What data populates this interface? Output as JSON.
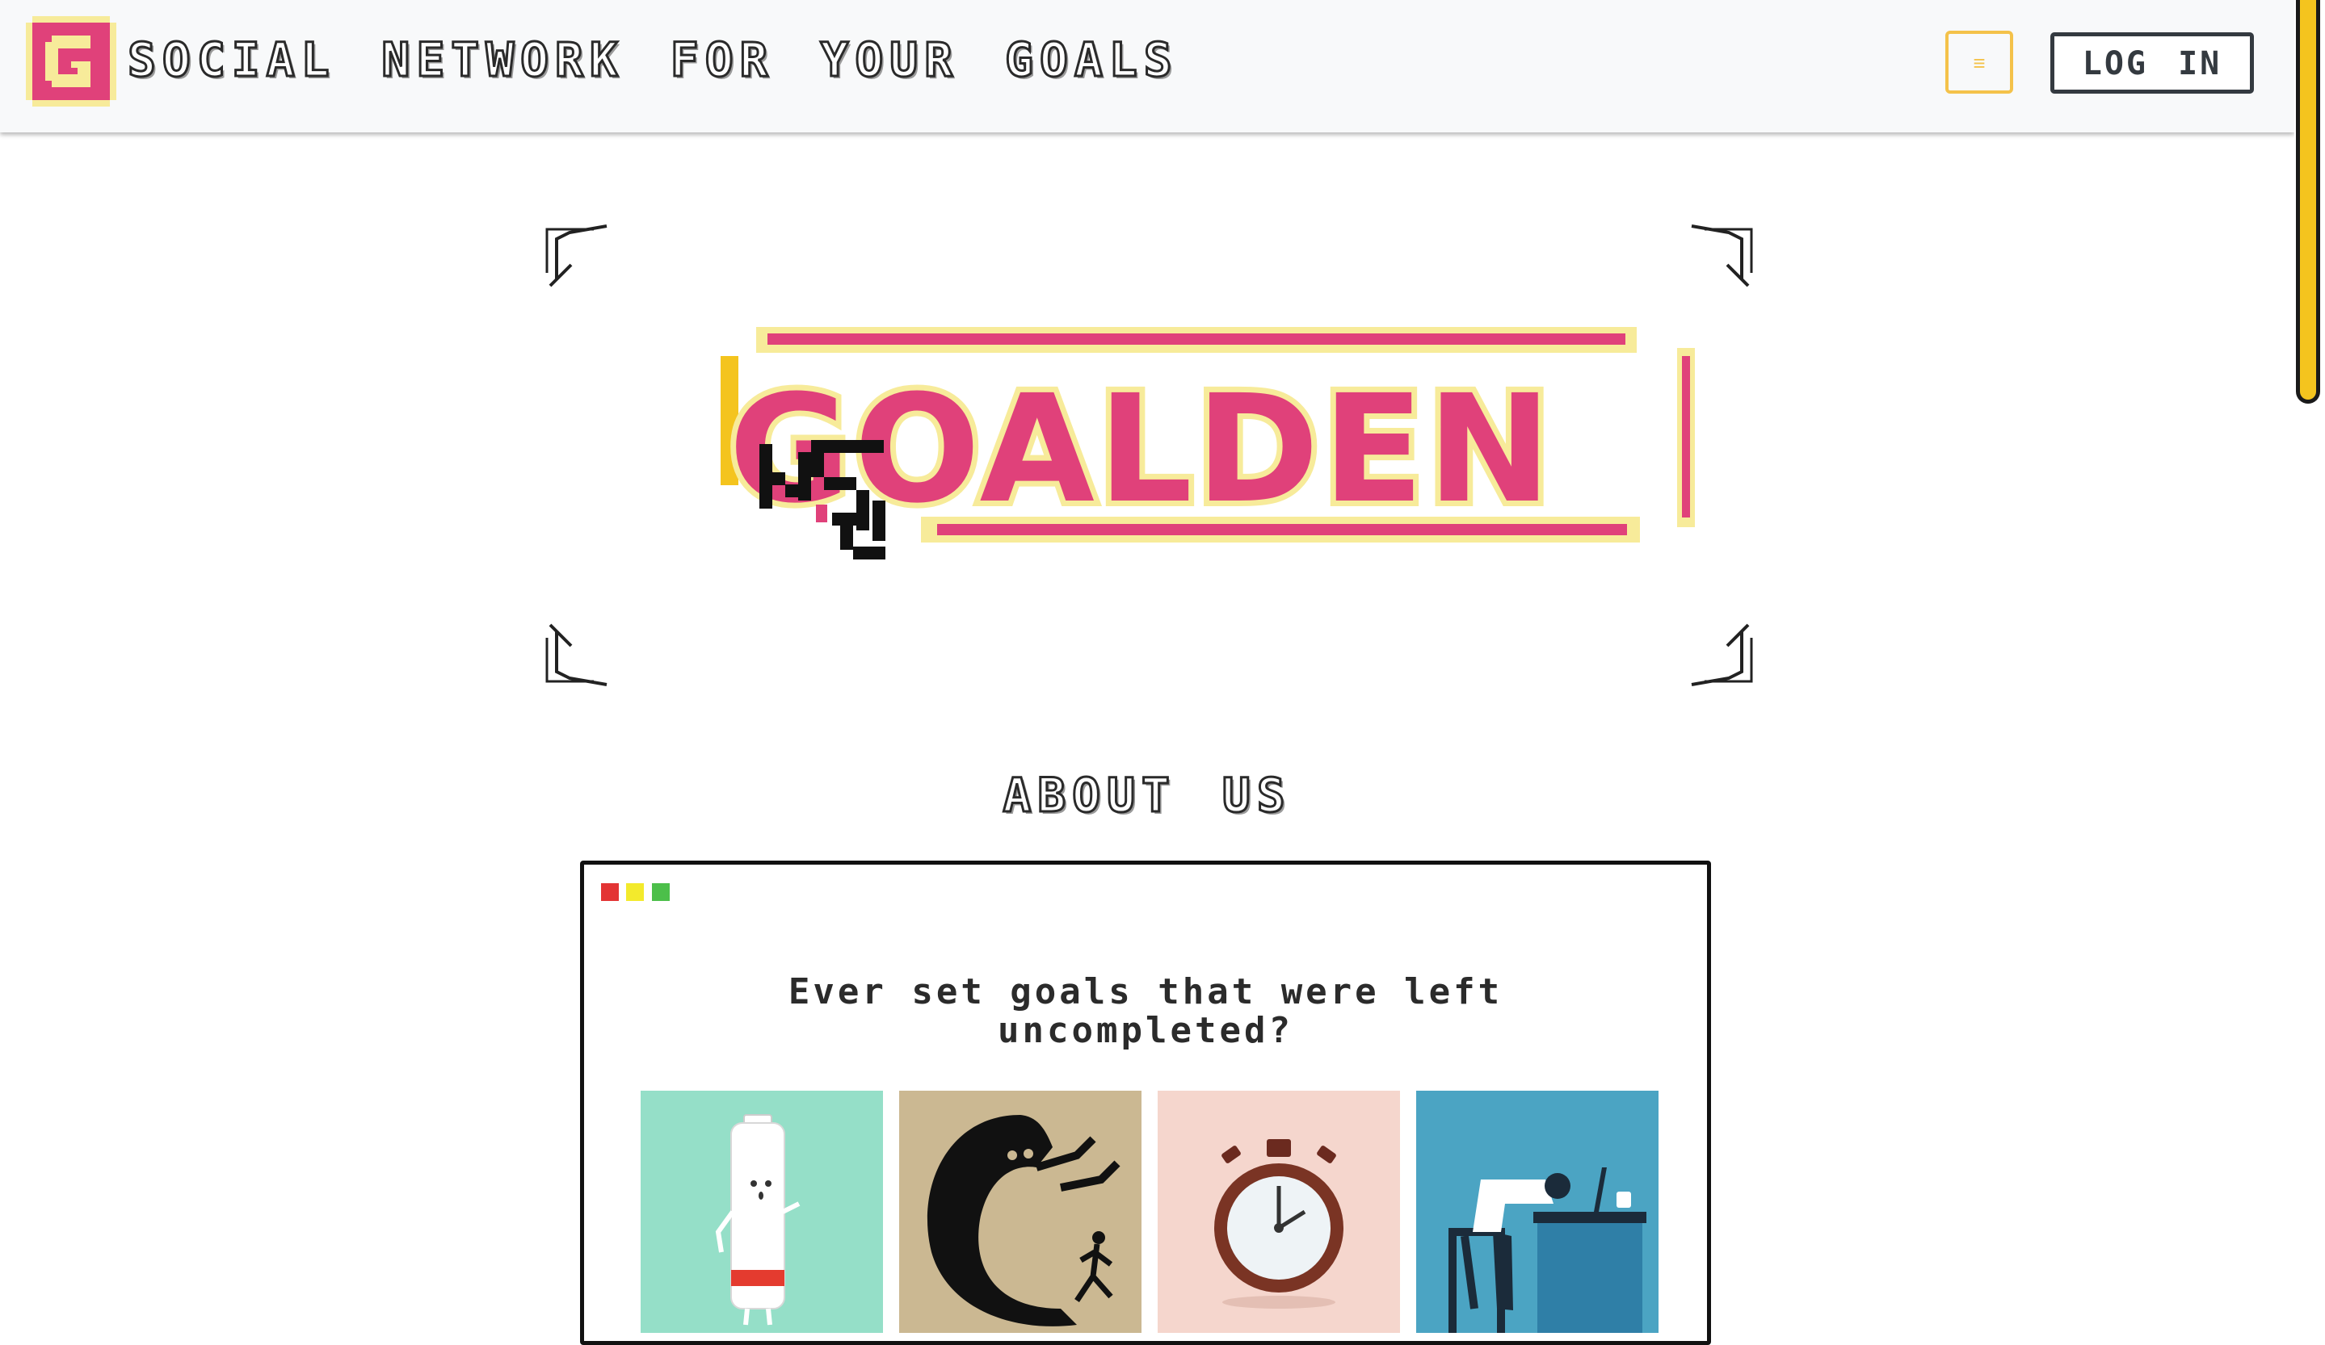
{
  "header": {
    "site_title": "Social network for your goals",
    "menu_icon": "hamburger-icon",
    "menu_glyph": "≡",
    "login_label": "LOG IN"
  },
  "hero": {
    "logo_text": "GOALDEN"
  },
  "about": {
    "title": "About us",
    "question": "Ever set goals that were left uncompleted?",
    "window_dots": [
      "red",
      "yellow",
      "green"
    ],
    "images": [
      {
        "name": "low-battery-character-image"
      },
      {
        "name": "shadow-monster-chasing-man-image"
      },
      {
        "name": "stopwatch-image"
      },
      {
        "name": "tired-office-worker-image"
      }
    ]
  },
  "colors": {
    "accent_yellow": "#f4c24a",
    "brand_pink": "#e0417a",
    "brand_cream": "#f7eb9a",
    "dark": "#343a40",
    "header_bg": "#f8f9fa"
  }
}
